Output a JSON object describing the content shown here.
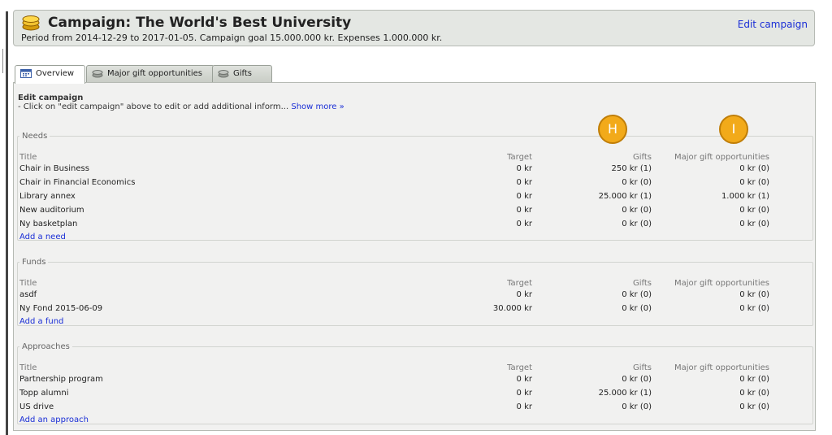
{
  "campaign": {
    "title": "Campaign: The World's Best University",
    "subtitle": "Period from 2014-12-29 to 2017-01-05. Campaign goal 15.000.000 kr. Expenses 1.000.000 kr.",
    "edit_link": "Edit campaign",
    "icon": "coins-icon"
  },
  "tabs": [
    {
      "label": "Overview",
      "icon": "calendar-icon",
      "active": true
    },
    {
      "label": "Major gift opportunities",
      "icon": "coins-icon",
      "active": false
    },
    {
      "label": "Gifts",
      "icon": "coins-icon",
      "active": false
    }
  ],
  "edit_section": {
    "title": "Edit campaign",
    "description": "- Click on \"edit campaign\" above to edit or add additional inform...",
    "show_more": "Show more »"
  },
  "columns": {
    "title": "Title",
    "target": "Target",
    "gifts": "Gifts",
    "major": "Major gift opportunities"
  },
  "sections": {
    "needs": {
      "legend": "Needs",
      "rows": [
        {
          "title": "Chair in Business",
          "target": "0 kr",
          "gifts": "250 kr (1)",
          "major": "0 kr (0)"
        },
        {
          "title": "Chair in Financial Economics",
          "target": "0 kr",
          "gifts": "0 kr (0)",
          "major": "0 kr (0)"
        },
        {
          "title": "Library annex",
          "target": "0 kr",
          "gifts": "25.000 kr (1)",
          "major": "1.000 kr (1)"
        },
        {
          "title": "New auditorium",
          "target": "0 kr",
          "gifts": "0 kr (0)",
          "major": "0 kr (0)"
        },
        {
          "title": "Ny basketplan",
          "target": "0 kr",
          "gifts": "0 kr (0)",
          "major": "0 kr (0)"
        }
      ],
      "add_link": "Add a need"
    },
    "funds": {
      "legend": "Funds",
      "rows": [
        {
          "title": "asdf",
          "target": "0 kr",
          "gifts": "0 kr (0)",
          "major": "0 kr (0)"
        },
        {
          "title": "Ny Fond 2015-06-09",
          "target": "30.000 kr",
          "gifts": "0 kr (0)",
          "major": "0 kr (0)"
        }
      ],
      "add_link": "Add a fund"
    },
    "approaches": {
      "legend": "Approaches",
      "rows": [
        {
          "title": "Partnership program",
          "target": "0 kr",
          "gifts": "0 kr (0)",
          "major": "0 kr (0)"
        },
        {
          "title": "Topp alumni",
          "target": "0 kr",
          "gifts": "25.000 kr (1)",
          "major": "0 kr (0)"
        },
        {
          "title": "US drive",
          "target": "0 kr",
          "gifts": "0 kr (0)",
          "major": "0 kr (0)"
        }
      ],
      "add_link": "Add an approach"
    }
  },
  "badges": [
    {
      "label": "H",
      "color": "#f2aa1a"
    },
    {
      "label": "I",
      "color": "#f2aa1a"
    }
  ]
}
